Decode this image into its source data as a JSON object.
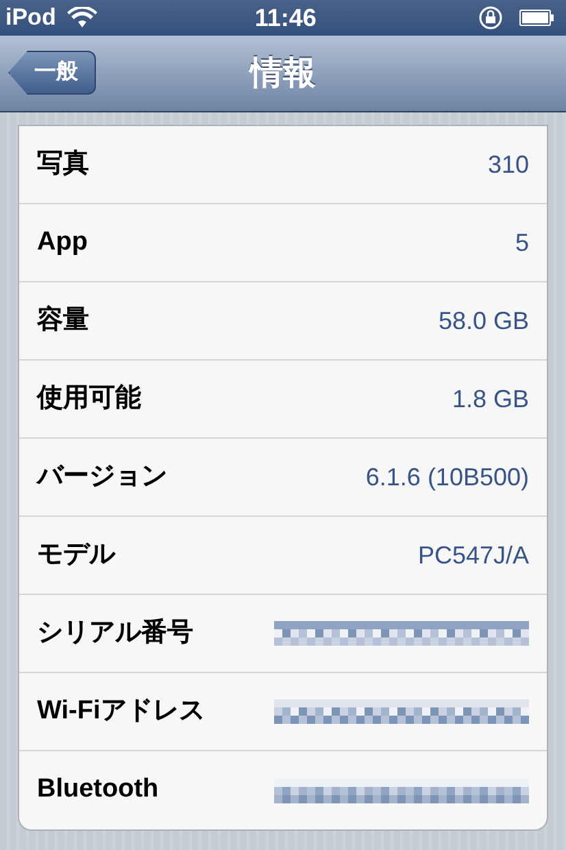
{
  "status_bar": {
    "carrier": "iPod",
    "time": "11:46"
  },
  "nav": {
    "back": "一般",
    "title": "情報"
  },
  "rows": [
    {
      "kind": "text",
      "label": "写真",
      "value": "310"
    },
    {
      "kind": "text",
      "label": "App",
      "value": "5"
    },
    {
      "kind": "text",
      "label": "容量",
      "value": "58.0 GB"
    },
    {
      "kind": "text",
      "label": "使用可能",
      "value": "1.8 GB"
    },
    {
      "kind": "text",
      "label": "バージョン",
      "value": "6.1.6 (10B500)"
    },
    {
      "kind": "text",
      "label": "モデル",
      "value": "PC547J/A"
    },
    {
      "kind": "redacted",
      "label": "シリアル番号"
    },
    {
      "kind": "redacted",
      "label": "Wi-Fiアドレス"
    },
    {
      "kind": "redacted",
      "label": "Bluetooth"
    }
  ]
}
